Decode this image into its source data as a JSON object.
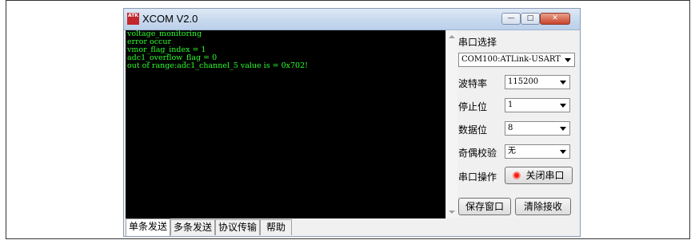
{
  "window": {
    "icon_text": "ATK",
    "title": "XCOM V2.0",
    "controls": {
      "minimize": "—",
      "maximize": "□",
      "close": "✕"
    }
  },
  "terminal": {
    "lines": [
      "voltage_monitoring",
      "error occur",
      "vmor_flag_index = 1",
      "adc1_overflow_flag = 0",
      "out of range:adc1_channel_5 value is = 0x702!"
    ]
  },
  "settings": {
    "port_label": "串口选择",
    "port_value": "COM100:ATLink-USART",
    "baud_label": "波特率",
    "baud_value": "115200",
    "stop_label": "停止位",
    "stop_value": "1",
    "data_label": "数据位",
    "data_value": "8",
    "parity_label": "奇偶校验",
    "parity_value": "无",
    "op_label": "串口操作",
    "op_button": "关闭串口",
    "save_button": "保存窗口",
    "clear_button": "清除接收"
  },
  "tabs": [
    "单条发送",
    "多条发送",
    "协议传输",
    "帮助"
  ]
}
